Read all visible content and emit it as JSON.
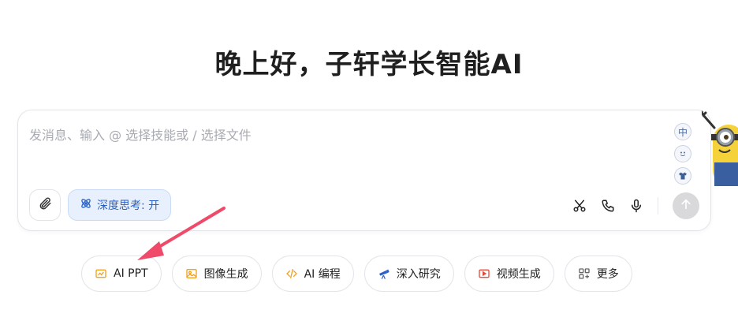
{
  "header": {
    "greeting": "晚上好，子轩学长智能AI"
  },
  "composer": {
    "placeholder": "发消息、输入 @ 选择技能或 / 选择文件",
    "deep_think_label": "深度思考: 开"
  },
  "side_icons": [
    {
      "label": "中",
      "icon": "chinese-input-icon"
    },
    {
      "label": "",
      "icon": "emoji-icon"
    },
    {
      "label": "",
      "icon": "shirt-icon"
    }
  ],
  "chips": [
    {
      "label": "AI PPT",
      "icon": "ppt-icon",
      "color": "#f0a020"
    },
    {
      "label": "图像生成",
      "icon": "image-icon",
      "color": "#f0a020"
    },
    {
      "label": "AI 编程",
      "icon": "code-icon",
      "color": "#f0a020"
    },
    {
      "label": "深入研究",
      "icon": "telescope-icon",
      "color": "#2a62c8"
    },
    {
      "label": "视频生成",
      "icon": "video-icon",
      "color": "#e64a3b"
    },
    {
      "label": "更多",
      "icon": "grid-icon",
      "color": "#666666"
    }
  ],
  "colors": {
    "accent": "#2a62c8",
    "annotation_arrow": "#ef4a6a"
  }
}
